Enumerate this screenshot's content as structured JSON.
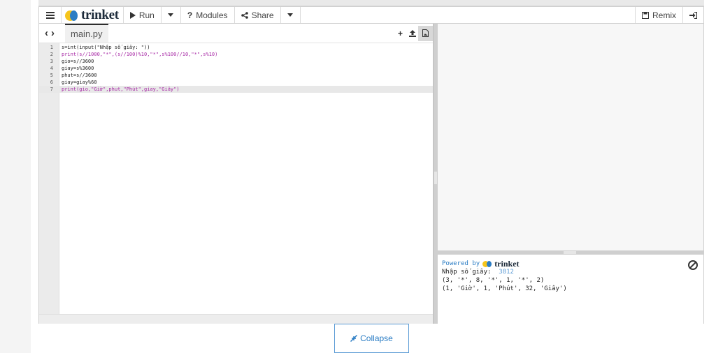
{
  "toolbar": {
    "menu_icon": "hamburger-icon",
    "brand": "trinket",
    "run_label": "Run",
    "modules_label": "Modules",
    "share_label": "Share",
    "remix_label": "Remix"
  },
  "editor": {
    "filename": "main.py",
    "lines": [
      {
        "num": "1",
        "code": "s=int(input(\"Nhập số giây: \"))"
      },
      {
        "num": "2",
        "code": "print(s//1000,\"*\",(s//100)%10,\"*\",s%100//10,\"*\",s%10)"
      },
      {
        "num": "3",
        "code": "gio=s//3600"
      },
      {
        "num": "4",
        "code": "giay=s%3600"
      },
      {
        "num": "5",
        "code": "phut=s//3600"
      },
      {
        "num": "6",
        "code": "giay=giay%60"
      },
      {
        "num": "7",
        "code": "print(gio,\"Giờ\",phut,\"Phút\",giay,\"Giây\")"
      }
    ],
    "active_line": 7
  },
  "console": {
    "powered_by": "Powered by",
    "brand": "trinket",
    "prompt": "Nhập số giây:",
    "input_value": "3812",
    "output_lines": [
      "(3, '*', 8, '*', 1, '*', 2)",
      "(1, 'Giờ', 1, 'Phút', 32, 'Giây')"
    ]
  },
  "footer": {
    "collapse_label": "Collapse"
  },
  "colors": {
    "accent": "#2b7dc4",
    "brand_yellow": "#f6c51c"
  }
}
